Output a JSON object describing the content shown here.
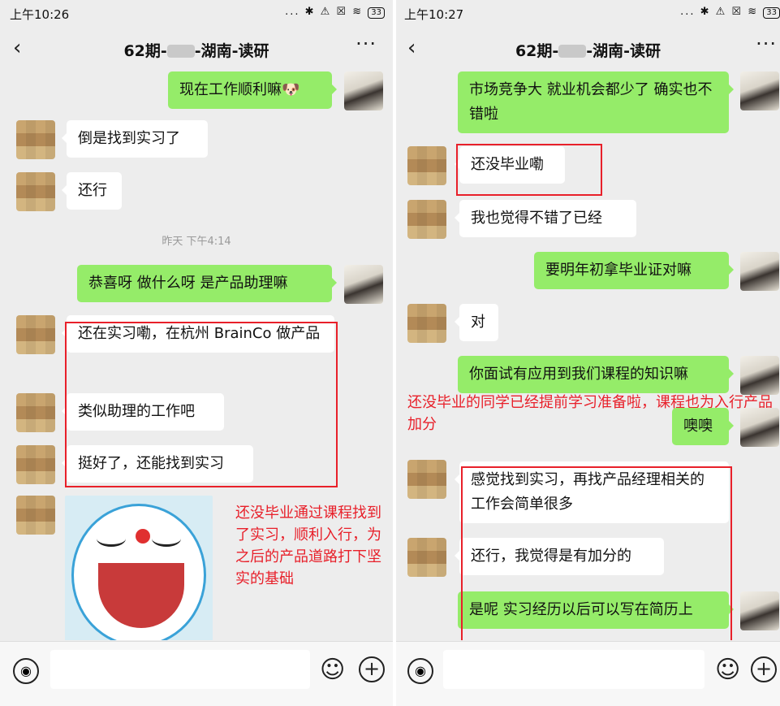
{
  "left": {
    "status": {
      "time": "上午10:26",
      "icons": "... ✱ ⚠ ☒ ≋",
      "battery": "33"
    },
    "title_prefix": "62期-",
    "title_suffix": "-湖南-读研",
    "messages": {
      "m1": "现在工作顺利嘛🐶",
      "m2": "倒是找到实习了",
      "m3": "还行",
      "ts": "昨天 下午4:14",
      "m4": "恭喜呀  做什么呀 是产品助理嘛",
      "m5": "还在实习嘞，在杭州 BrainCo 做产品",
      "m6": "类似助理的工作吧",
      "m7": "挺好了，还能找到实习"
    },
    "annotation": "还没毕业通过课程找到了实习，顺利入行，为之后的产品道路打下坚实的基础"
  },
  "right": {
    "status": {
      "time": "上午10:27",
      "icons": "... ✱ ⚠ ☒ ≋",
      "battery": "33"
    },
    "title_prefix": "62期-",
    "title_suffix": "-湖南-读研",
    "messages": {
      "r1": "市场竞争大 就业机会都少了 确实也不错啦",
      "r2": "还没毕业嘞",
      "r3": "我也觉得不错了已经",
      "r4": "要明年初拿毕业证对嘛",
      "r5": "对",
      "r6": "你面试有应用到我们课程的知识嘛",
      "r7": "噢噢",
      "r8": "感觉找到实习，再找产品经理相关的工作会简单很多",
      "r9": "还行，我觉得是有加分的",
      "r10": "是呢  实习经历以后可以写在简历上"
    },
    "annotation": "还没毕业的同学已经提前学习准备啦，课程也为入行产品加分"
  },
  "icons": {
    "back": "‹",
    "more": "···",
    "voice": "◉",
    "emoji": "☺",
    "plus": "+"
  },
  "colors": {
    "my_bubble": "#95ec69",
    "annotation": "#e8202a",
    "background": "#ededed"
  }
}
